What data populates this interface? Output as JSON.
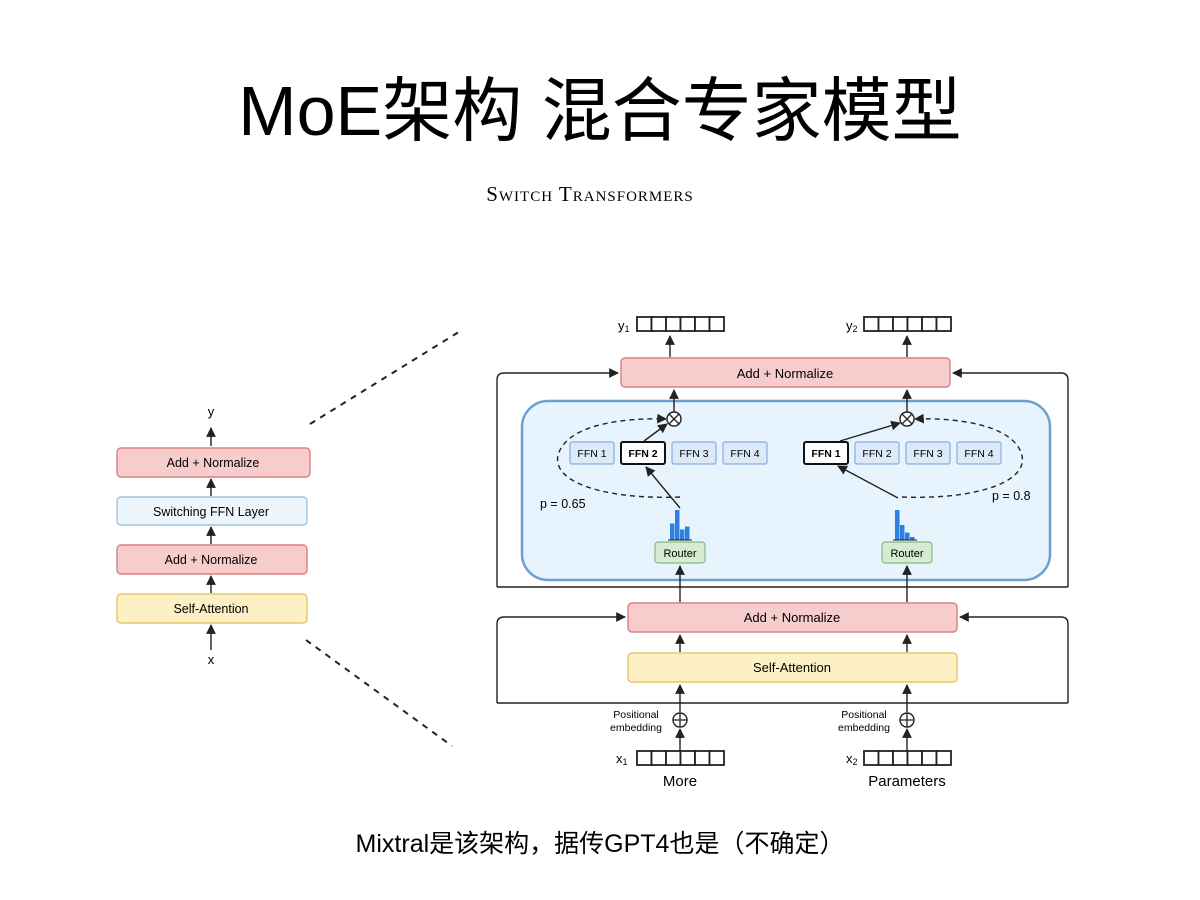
{
  "page": {
    "title": "MoE架构 混合专家模型",
    "subtitle": "Switch Transformers",
    "caption": "Mixtral是该架构，据传GPT4也是（不确定）"
  },
  "left_block": {
    "y_label": "y",
    "x_label": "x",
    "add_normalize_top": "Add + Normalize",
    "switching_ffn": "Switching FFN Layer",
    "add_normalize_bottom": "Add + Normalize",
    "self_attention": "Self-Attention"
  },
  "right_block": {
    "outputs": [
      {
        "symbol": "y",
        "sub": "1"
      },
      {
        "symbol": "y",
        "sub": "2"
      }
    ],
    "add_normalize_top": "Add + Normalize",
    "add_normalize_mid": "Add + Normalize",
    "self_attention": "Self-Attention",
    "router_label": "Router",
    "token1": {
      "experts": [
        "FFN 1",
        "FFN 2",
        "FFN 3",
        "FFN 4"
      ],
      "selected_index": 1,
      "prob_label": "p = 0.65",
      "router_bars": [
        0.55,
        1.0,
        0.35,
        0.45
      ]
    },
    "token2": {
      "experts": [
        "FFN 1",
        "FFN 2",
        "FFN 3",
        "FFN 4"
      ],
      "selected_index": 0,
      "prob_label": "p = 0.8",
      "router_bars": [
        1.0,
        0.5,
        0.25,
        0.1
      ]
    },
    "positional_embedding": [
      "Positional",
      "embedding"
    ],
    "inputs": [
      {
        "symbol": "x",
        "sub": "1",
        "word": "More"
      },
      {
        "symbol": "x",
        "sub": "2",
        "word": "Parameters"
      }
    ]
  },
  "colors": {
    "add_normalize_fill": "#f7cccd",
    "add_normalize_stroke": "#d98080",
    "switching_fill": "#eef6fd",
    "switching_stroke": "#9ec3e0",
    "attention_fill": "#fdf0c4",
    "attention_stroke": "#e4c76a",
    "moe_panel_fill": "#e7f4fd",
    "moe_panel_stroke": "#6f9fcf",
    "expert_fill": "#dce9f8",
    "expert_stroke": "#8aaedb",
    "router_fill": "#d4ecd0",
    "router_stroke": "#88b882",
    "bar_color": "#2f7fe0"
  }
}
